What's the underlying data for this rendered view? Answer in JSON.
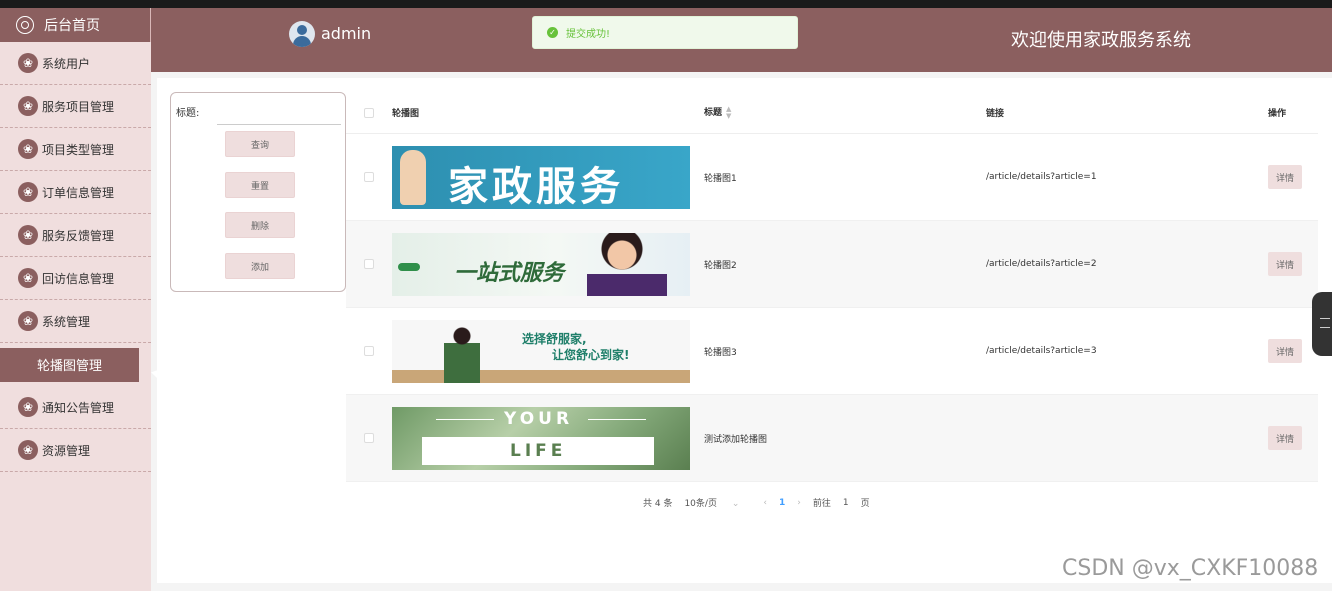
{
  "sidebar": {
    "home": "后台首页",
    "items": [
      "系统用户",
      "服务项目管理",
      "项目类型管理",
      "订单信息管理",
      "服务反馈管理",
      "回访信息管理",
      "系统管理"
    ],
    "active": "轮播图管理",
    "items_after": [
      "通知公告管理",
      "资源管理"
    ]
  },
  "header": {
    "username": "admin",
    "title": "欢迎使用家政服务系统"
  },
  "toast": {
    "text": "提交成功!"
  },
  "search": {
    "label": "标题:",
    "placeholder": "",
    "buttons": [
      "查询",
      "重置",
      "删除",
      "添加"
    ]
  },
  "table": {
    "headers": {
      "image": "轮播图",
      "title": "标题",
      "link": "链接",
      "op": "操作"
    },
    "rows": [
      {
        "banner": {
          "text": "家政服务"
        },
        "title": "轮播图1",
        "link": "/article/details?article=1",
        "op": "详情"
      },
      {
        "banner": {
          "text": "一站式服务"
        },
        "title": "轮播图2",
        "link": "/article/details?article=2",
        "op": "详情"
      },
      {
        "banner": {
          "text": "选择舒服家,",
          "text2": "让您舒心到家!"
        },
        "title": "轮播图3",
        "link": "/article/details?article=3",
        "op": "详情"
      },
      {
        "banner": {
          "text": "YOUR",
          "text2": "LIFE"
        },
        "title": "测试添加轮播图",
        "link": "",
        "op": "详情"
      }
    ]
  },
  "pager": {
    "total": "共 4 条",
    "size": "10条/页",
    "current": "1",
    "goto": "前往",
    "goto_value": "1",
    "page_unit": "页"
  },
  "watermark": "CSDN @vx_CXKF10088",
  "colors": {
    "primary": "#8b5f5f",
    "sidebar_bg": "#f0dede",
    "success": "#67c23a"
  }
}
